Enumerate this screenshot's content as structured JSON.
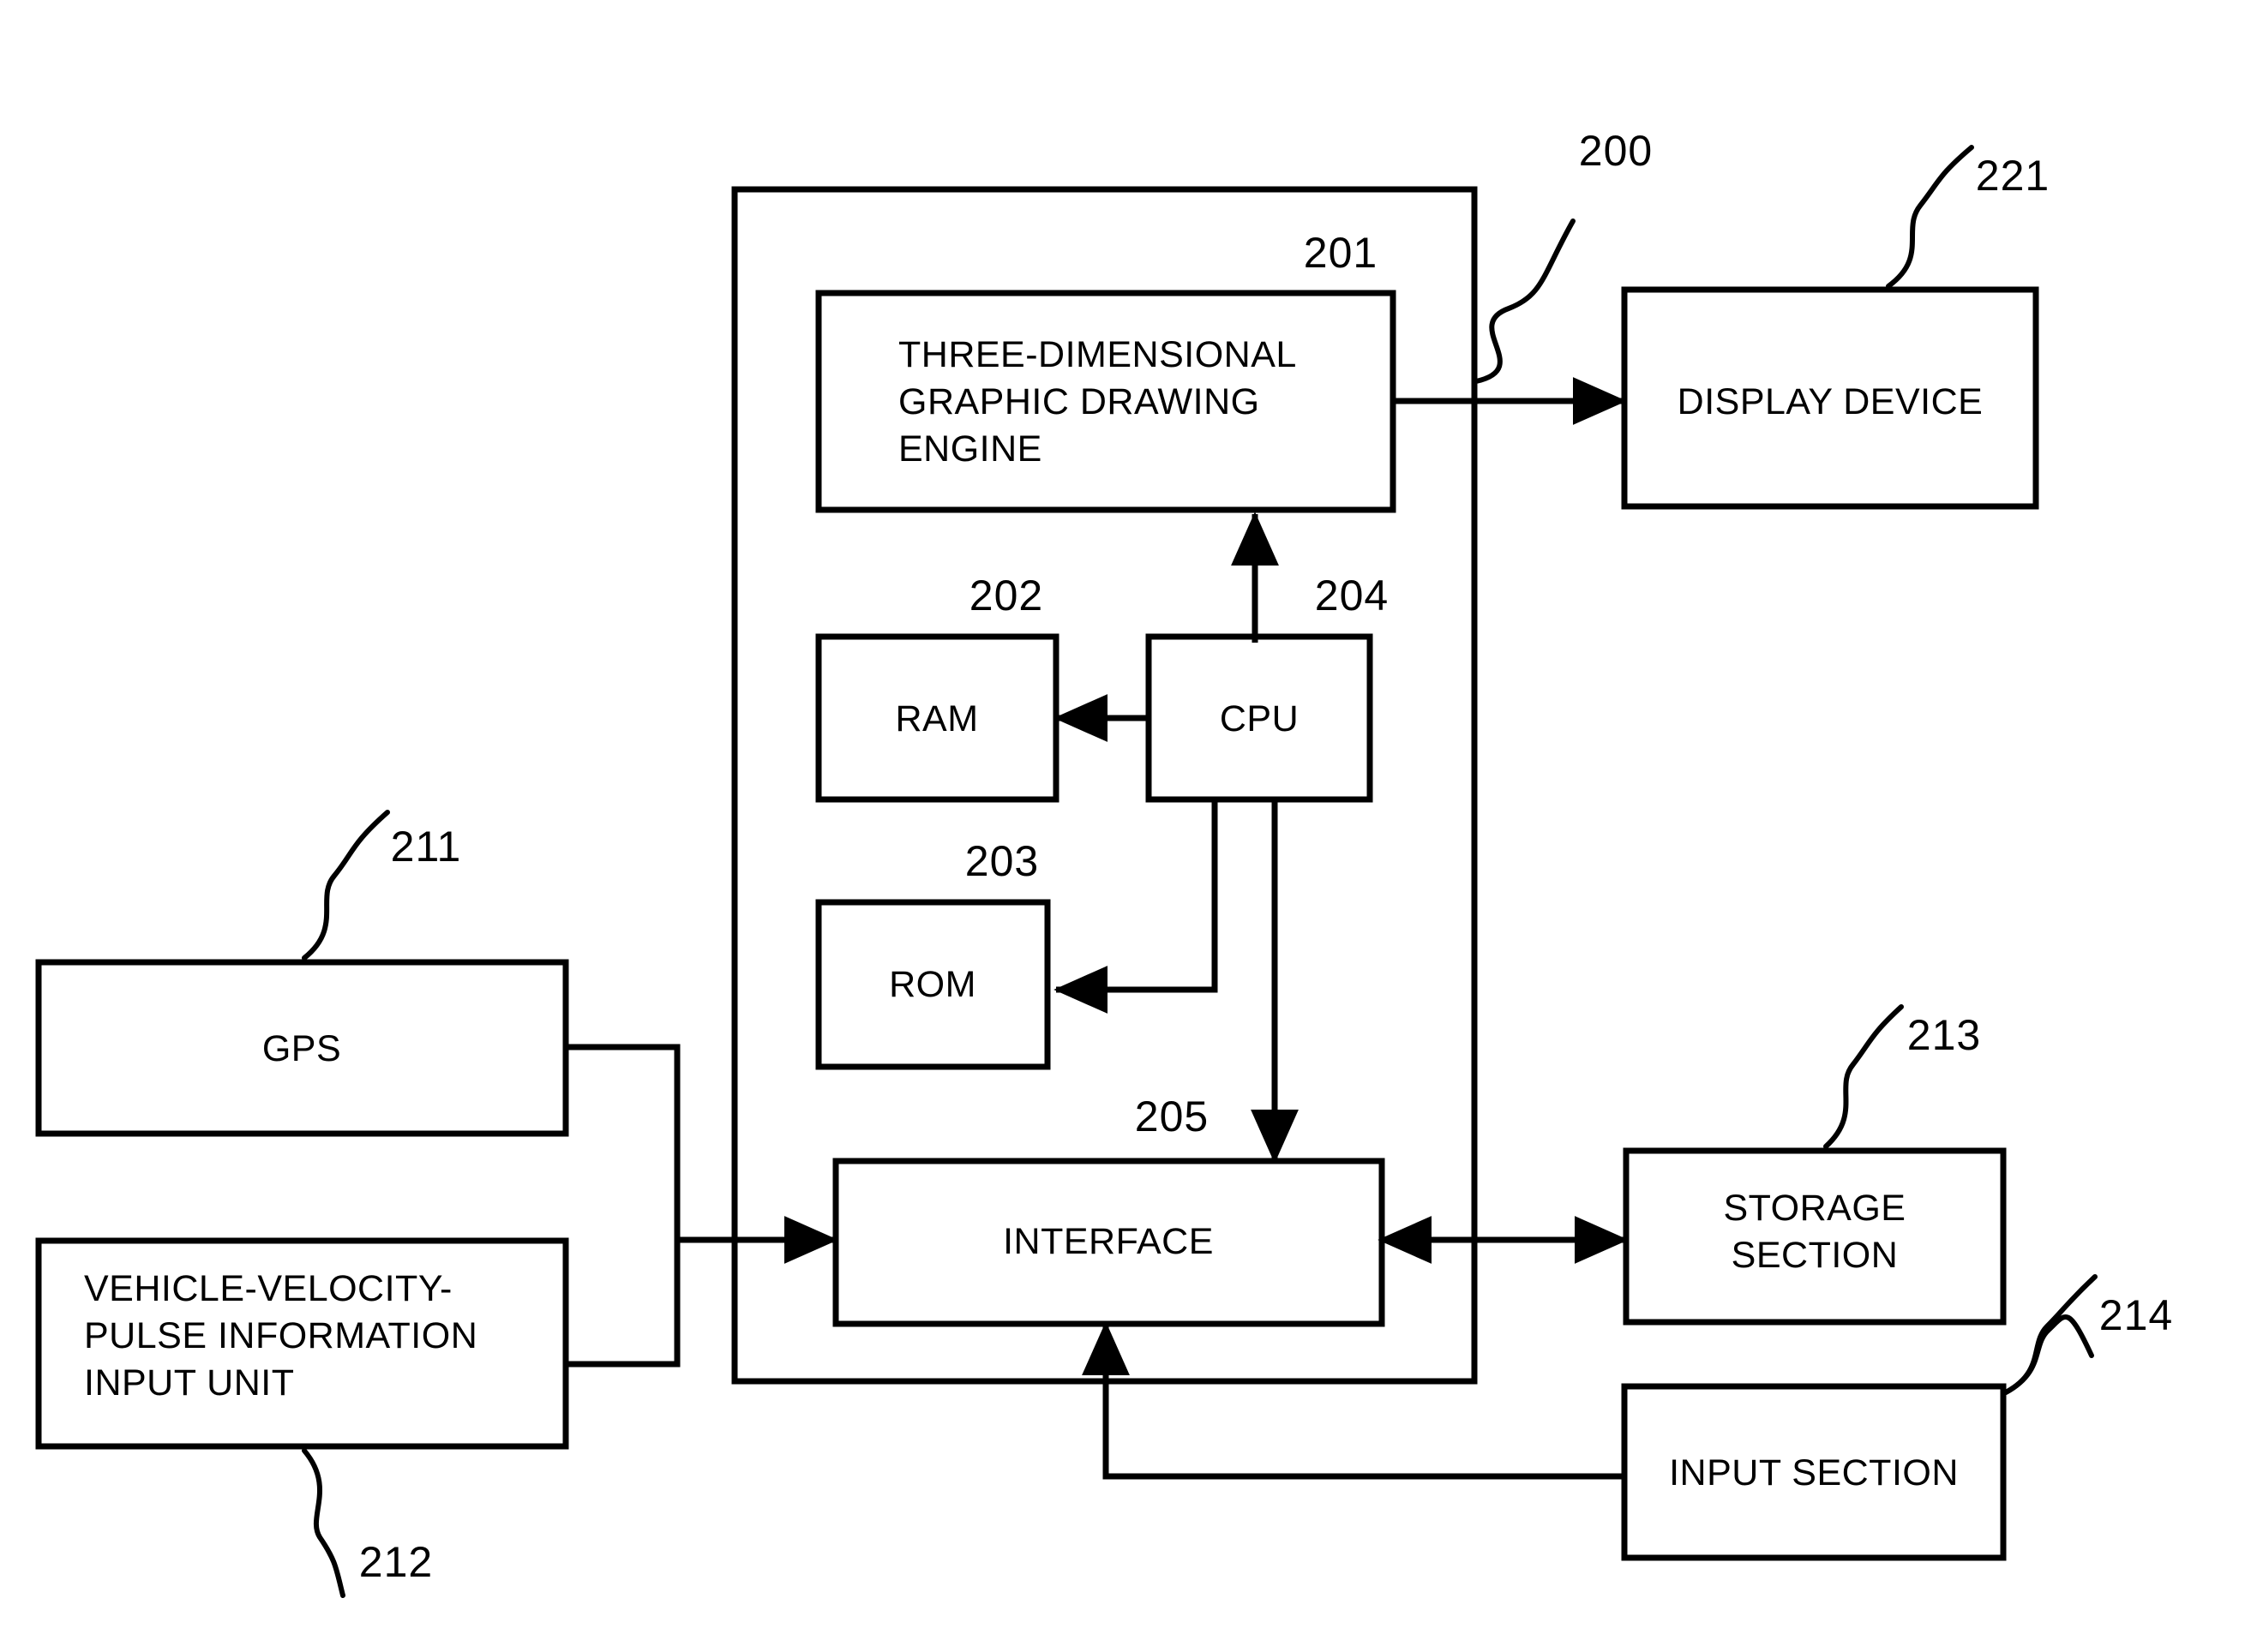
{
  "figure": {
    "type": "patent-block-diagram",
    "background_color": "#ffffff",
    "line_color": "#000000"
  },
  "blocks": {
    "system_enclosure": {
      "ref": "200",
      "label": ""
    },
    "engine": {
      "ref": "201",
      "lines": [
        "THREE-DIMENSIONAL",
        "GRAPHIC DRAWING",
        "ENGINE"
      ],
      "align": "left"
    },
    "ram": {
      "ref": "202",
      "lines": [
        "RAM"
      ],
      "align": "center"
    },
    "rom": {
      "ref": "203",
      "lines": [
        "ROM"
      ],
      "align": "center"
    },
    "cpu": {
      "ref": "204",
      "lines": [
        "CPU"
      ],
      "align": "center"
    },
    "interface": {
      "ref": "205",
      "lines": [
        "INTERFACE"
      ],
      "align": "center"
    },
    "gps": {
      "ref": "211",
      "lines": [
        "GPS"
      ],
      "align": "center"
    },
    "vehicle_pulse": {
      "ref": "212",
      "lines": [
        "VEHICLE-VELOCITY-",
        "PULSE INFORMATION",
        "INPUT UNIT"
      ],
      "align": "left"
    },
    "storage": {
      "ref": "213",
      "lines": [
        "STORAGE",
        "SECTION"
      ],
      "align": "center"
    },
    "input_section": {
      "ref": "214",
      "lines": [
        "INPUT SECTION"
      ],
      "align": "center"
    },
    "display": {
      "ref": "221",
      "lines": [
        "DISPLAY DEVICE"
      ],
      "align": "center"
    }
  },
  "reference_numerals": {
    "n200": "200",
    "n201": "201",
    "n202": "202",
    "n203": "203",
    "n204": "204",
    "n205": "205",
    "n211": "211",
    "n212": "212",
    "n213": "213",
    "n214": "214",
    "n221": "221"
  },
  "connections": [
    {
      "from": "engine",
      "to": "display",
      "arrow": "single"
    },
    {
      "from": "cpu",
      "to": "engine",
      "arrow": "single"
    },
    {
      "from": "cpu",
      "to": "ram",
      "arrow": "single"
    },
    {
      "from": "cpu",
      "to": "rom",
      "arrow": "single"
    },
    {
      "from": "cpu",
      "to": "interface",
      "arrow": "single"
    },
    {
      "from": "gps",
      "to": "interface",
      "arrow": "single"
    },
    {
      "from": "vehicle_pulse",
      "to": "interface",
      "arrow": "single"
    },
    {
      "from": "interface",
      "to": "storage",
      "arrow": "double"
    },
    {
      "from": "input_section",
      "to": "interface",
      "arrow": "single"
    }
  ]
}
